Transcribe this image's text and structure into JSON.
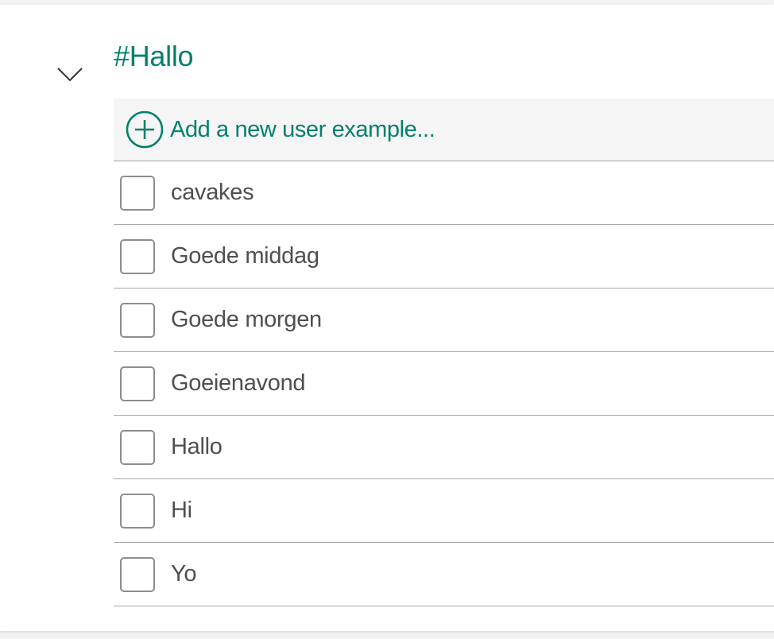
{
  "intent": {
    "title": "#Hallo"
  },
  "add_example": {
    "label": "Add a new user example..."
  },
  "examples": [
    {
      "text": "cavakes"
    },
    {
      "text": "Goede middag"
    },
    {
      "text": "Goede morgen"
    },
    {
      "text": "Goeienavond"
    },
    {
      "text": "Hallo"
    },
    {
      "text": "Hi"
    },
    {
      "text": "Yo"
    }
  ],
  "colors": {
    "accent": "#00806b",
    "text": "#4f4f4f",
    "divider": "#a8a8a8",
    "add_row_bg": "#f5f5f5",
    "page_bg": "#f2f2f2"
  },
  "icons": {
    "collapse": "chevron-down-icon",
    "add": "plus-circle-icon"
  }
}
